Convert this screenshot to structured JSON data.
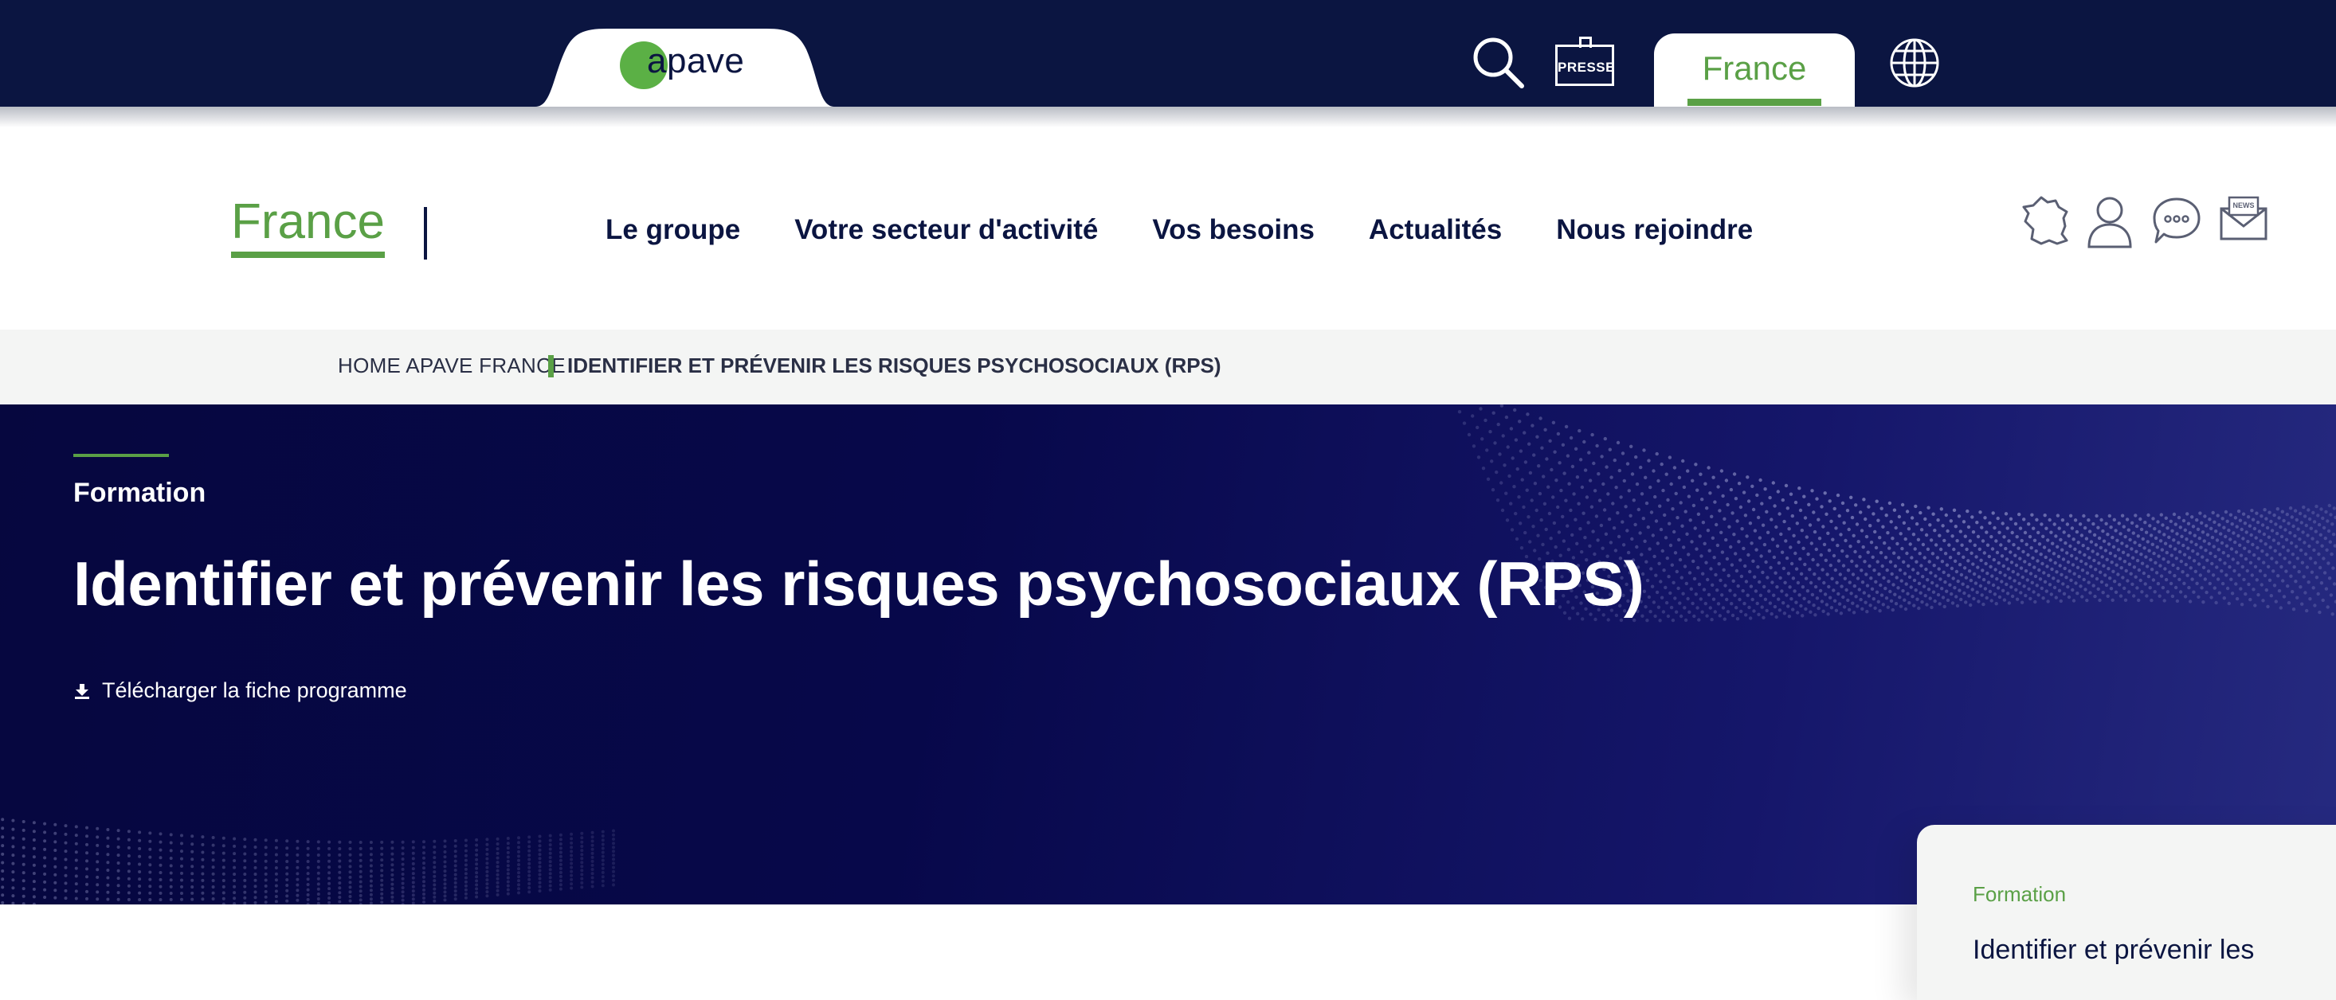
{
  "topbar": {
    "logo_text": "apave",
    "press_label": "PRESSE",
    "country_tab": "France",
    "icons": [
      "search-icon",
      "press-icon",
      "globe-icon"
    ]
  },
  "nav": {
    "site_country": "France",
    "menu": [
      {
        "label": "Le groupe"
      },
      {
        "label": "Votre secteur d'activité"
      },
      {
        "label": "Vos besoins"
      },
      {
        "label": "Actualités"
      },
      {
        "label": "Nous rejoindre"
      }
    ],
    "icons": [
      "france-map-icon",
      "user-icon",
      "chat-icon",
      "newsletter-icon"
    ],
    "newsletter_icon_text": "NEWS"
  },
  "breadcrumb": {
    "home": "HOME APAVE FRANCE",
    "current": "IDENTIFIER ET PRÉVENIR LES RISQUES PSYCHOSOCIAUX (RPS)"
  },
  "hero": {
    "kicker": "Formation",
    "title": "Identifier et prévenir les risques psychosociaux (RPS)",
    "download_label": "Télécharger la fiche programme"
  },
  "side_card": {
    "kicker": "Formation",
    "title": "Identifier et prévenir les"
  },
  "colors": {
    "navy": "#0b1541",
    "green": "#5aa046",
    "hero_dark": "#06073f",
    "breadcrumb_bg": "#f4f5f4"
  }
}
